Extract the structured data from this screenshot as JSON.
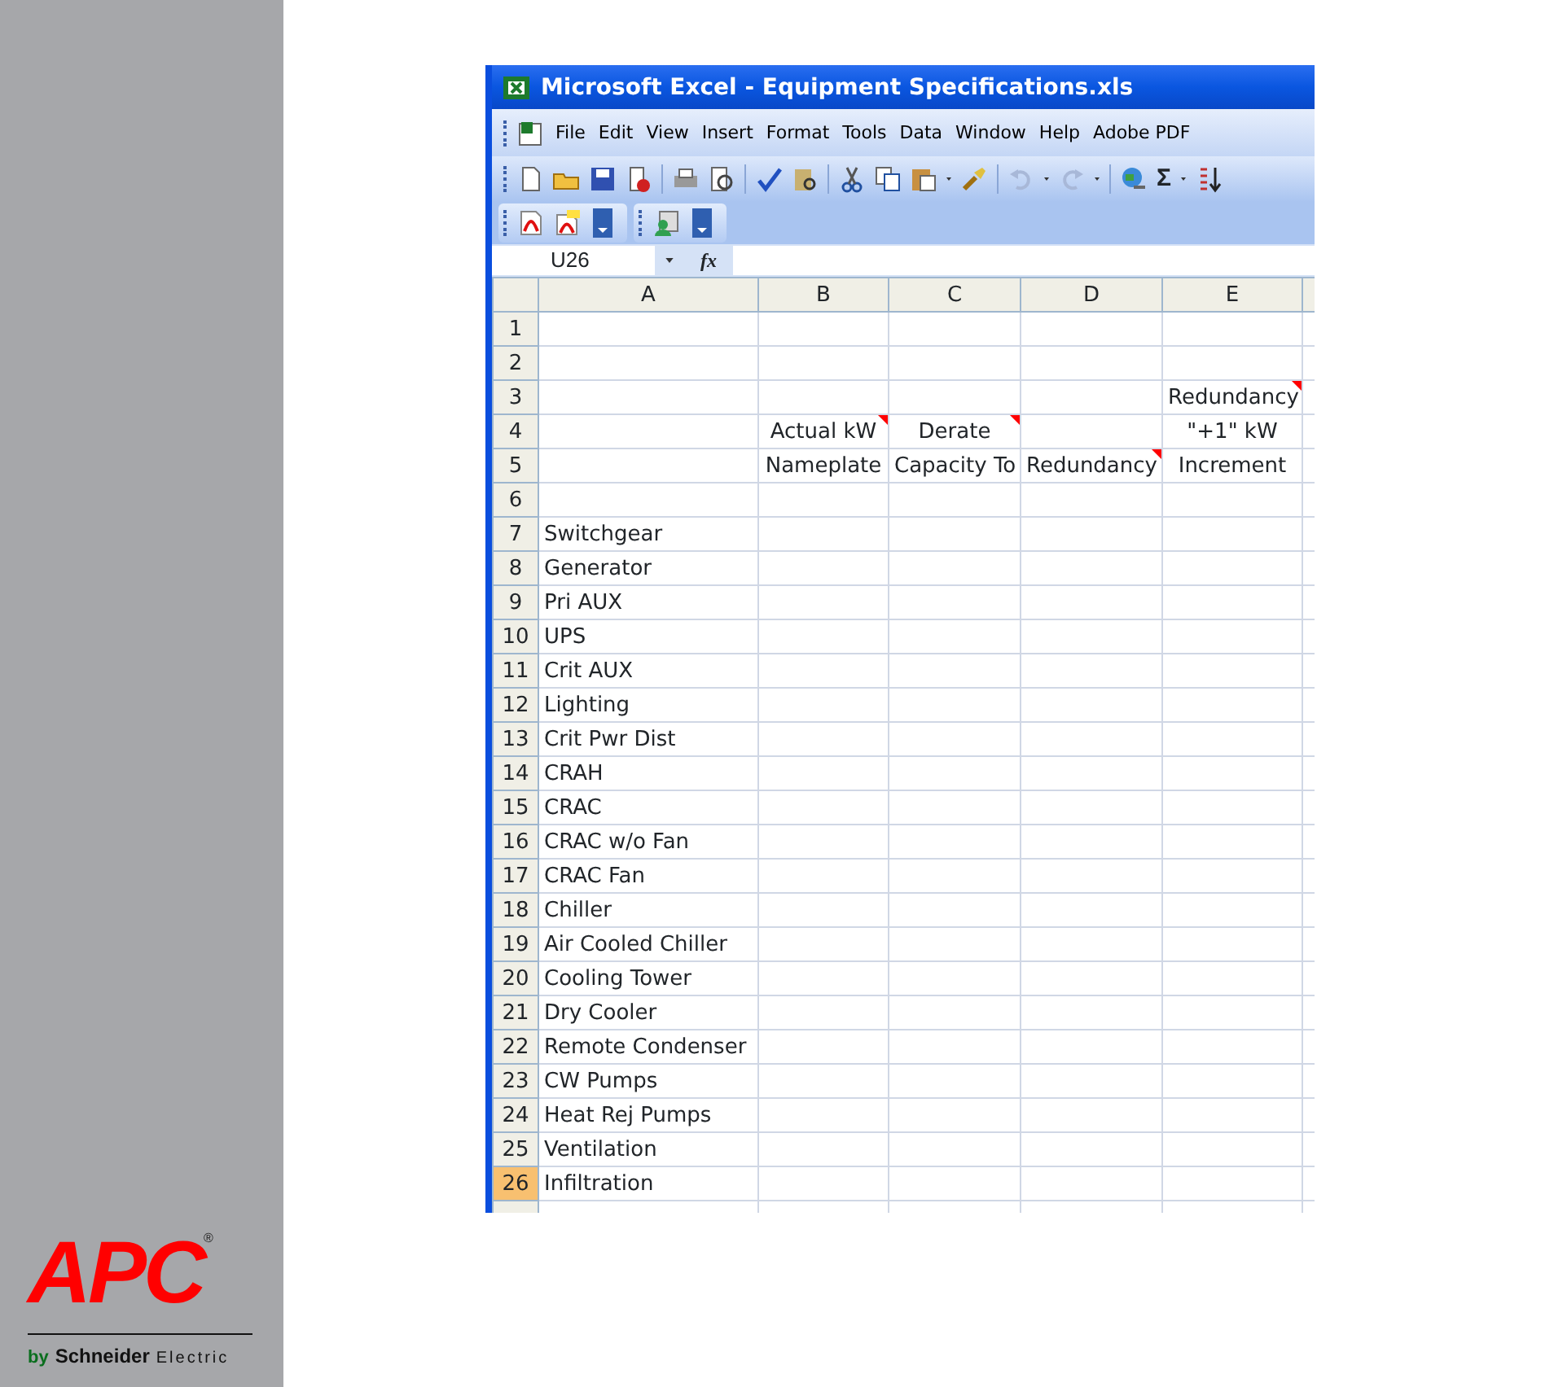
{
  "window": {
    "title": "Microsoft Excel - Equipment Specifications.xls"
  },
  "menu": [
    "File",
    "Edit",
    "View",
    "Insert",
    "Format",
    "Tools",
    "Data",
    "Window",
    "Help",
    "Adobe PDF"
  ],
  "toolbar": {
    "sum_symbol": "Σ"
  },
  "formula_bar": {
    "name_box": "U26",
    "fx_label": "fx"
  },
  "columns": [
    "A",
    "B",
    "C",
    "D",
    "E"
  ],
  "rows": [
    {
      "header": "1",
      "selected": false,
      "cells": {}
    },
    {
      "header": "2",
      "selected": false,
      "cells": {}
    },
    {
      "header": "3",
      "selected": false,
      "cells": {
        "E": {
          "text": "Redundancy",
          "comment": true
        }
      }
    },
    {
      "header": "4",
      "selected": false,
      "cells": {
        "B": {
          "text": "Actual kW",
          "comment": true
        },
        "C": {
          "text": "Derate",
          "comment": true
        },
        "E": {
          "text": "\"+1\" kW",
          "comment": false
        }
      }
    },
    {
      "header": "5",
      "selected": false,
      "cells": {
        "B": {
          "text": "Nameplate",
          "comment": false
        },
        "C": {
          "text": "Capacity To",
          "comment": false
        },
        "D": {
          "text": "Redundancy",
          "comment": true
        },
        "E": {
          "text": "Increment",
          "comment": false
        }
      }
    },
    {
      "header": "6",
      "selected": false,
      "cells": {}
    },
    {
      "header": "7",
      "selected": false,
      "cells": {
        "A": {
          "text": "Switchgear",
          "comment": false
        }
      }
    },
    {
      "header": "8",
      "selected": false,
      "cells": {
        "A": {
          "text": "Generator",
          "comment": false
        }
      }
    },
    {
      "header": "9",
      "selected": false,
      "cells": {
        "A": {
          "text": "Pri AUX",
          "comment": false
        }
      }
    },
    {
      "header": "10",
      "selected": false,
      "cells": {
        "A": {
          "text": "UPS",
          "comment": false
        }
      }
    },
    {
      "header": "11",
      "selected": false,
      "cells": {
        "A": {
          "text": "Crit AUX",
          "comment": false
        }
      }
    },
    {
      "header": "12",
      "selected": false,
      "cells": {
        "A": {
          "text": "Lighting",
          "comment": false
        }
      }
    },
    {
      "header": "13",
      "selected": false,
      "cells": {
        "A": {
          "text": "Crit Pwr Dist",
          "comment": false
        }
      }
    },
    {
      "header": "14",
      "selected": false,
      "cells": {
        "A": {
          "text": "CRAH",
          "comment": false
        }
      }
    },
    {
      "header": "15",
      "selected": false,
      "cells": {
        "A": {
          "text": "CRAC",
          "comment": false
        }
      }
    },
    {
      "header": "16",
      "selected": false,
      "cells": {
        "A": {
          "text": "CRAC w/o Fan",
          "comment": false
        }
      }
    },
    {
      "header": "17",
      "selected": false,
      "cells": {
        "A": {
          "text": "CRAC Fan",
          "comment": false
        }
      }
    },
    {
      "header": "18",
      "selected": false,
      "cells": {
        "A": {
          "text": "Chiller",
          "comment": false
        }
      }
    },
    {
      "header": "19",
      "selected": false,
      "cells": {
        "A": {
          "text": "Air Cooled Chiller",
          "comment": false
        }
      }
    },
    {
      "header": "20",
      "selected": false,
      "cells": {
        "A": {
          "text": "Cooling Tower",
          "comment": false
        }
      }
    },
    {
      "header": "21",
      "selected": false,
      "cells": {
        "A": {
          "text": "Dry Cooler",
          "comment": false
        }
      }
    },
    {
      "header": "22",
      "selected": false,
      "cells": {
        "A": {
          "text": "Remote Condenser",
          "comment": false
        }
      }
    },
    {
      "header": "23",
      "selected": false,
      "cells": {
        "A": {
          "text": "CW Pumps",
          "comment": false
        }
      }
    },
    {
      "header": "24",
      "selected": false,
      "cells": {
        "A": {
          "text": "Heat Rej Pumps",
          "comment": false
        }
      }
    },
    {
      "header": "25",
      "selected": false,
      "cells": {
        "A": {
          "text": "Ventilation",
          "comment": false
        }
      }
    },
    {
      "header": "26",
      "selected": true,
      "cells": {
        "A": {
          "text": "Infiltration",
          "comment": false
        }
      }
    }
  ],
  "logo": {
    "brand": "APC",
    "registered": "®",
    "by": "by",
    "company": "Schneider",
    "division": "Electric"
  }
}
